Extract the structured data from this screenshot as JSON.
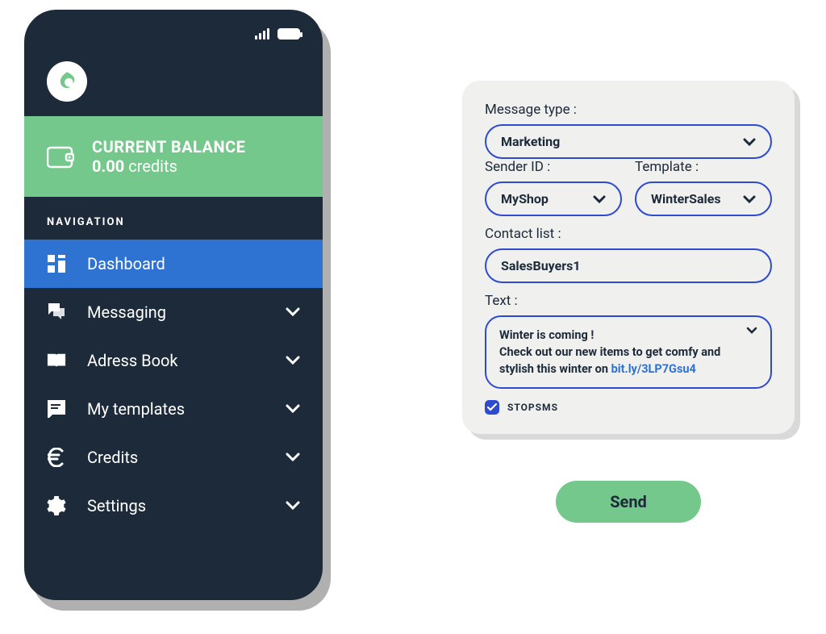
{
  "phone": {
    "balance": {
      "title": "CURRENT BALANCE",
      "value": "0.00",
      "unit": "credits"
    },
    "nav_header": "NAVIGATION",
    "nav": [
      {
        "label": "Dashboard",
        "active": true,
        "expandable": false
      },
      {
        "label": "Messaging",
        "active": false,
        "expandable": true
      },
      {
        "label": "Adress Book",
        "active": false,
        "expandable": true
      },
      {
        "label": "My templates",
        "active": false,
        "expandable": true
      },
      {
        "label": "Credits",
        "active": false,
        "expandable": true
      },
      {
        "label": "Settings",
        "active": false,
        "expandable": true
      }
    ]
  },
  "form": {
    "message_type": {
      "label": "Message type :",
      "value": "Marketing"
    },
    "sender_id": {
      "label": "Sender ID :",
      "value": "MyShop"
    },
    "template": {
      "label": "Template :",
      "value": "WinterSales"
    },
    "contact_list": {
      "label": "Contact list :",
      "value": "SalesBuyers1"
    },
    "text": {
      "label": "Text :",
      "line1": "Winter is coming !",
      "line2": "Check out our new items to get comfy and stylish this winter on ",
      "link": "bit.ly/3LP7Gsu4"
    },
    "stopsms": {
      "label": "STOPSMS",
      "checked": true
    }
  },
  "send_button": "Send",
  "colors": {
    "accent_green": "#74c88b",
    "accent_blue": "#2e72d2",
    "field_border": "#2e4bd0",
    "phone_bg": "#1d2a3a"
  }
}
